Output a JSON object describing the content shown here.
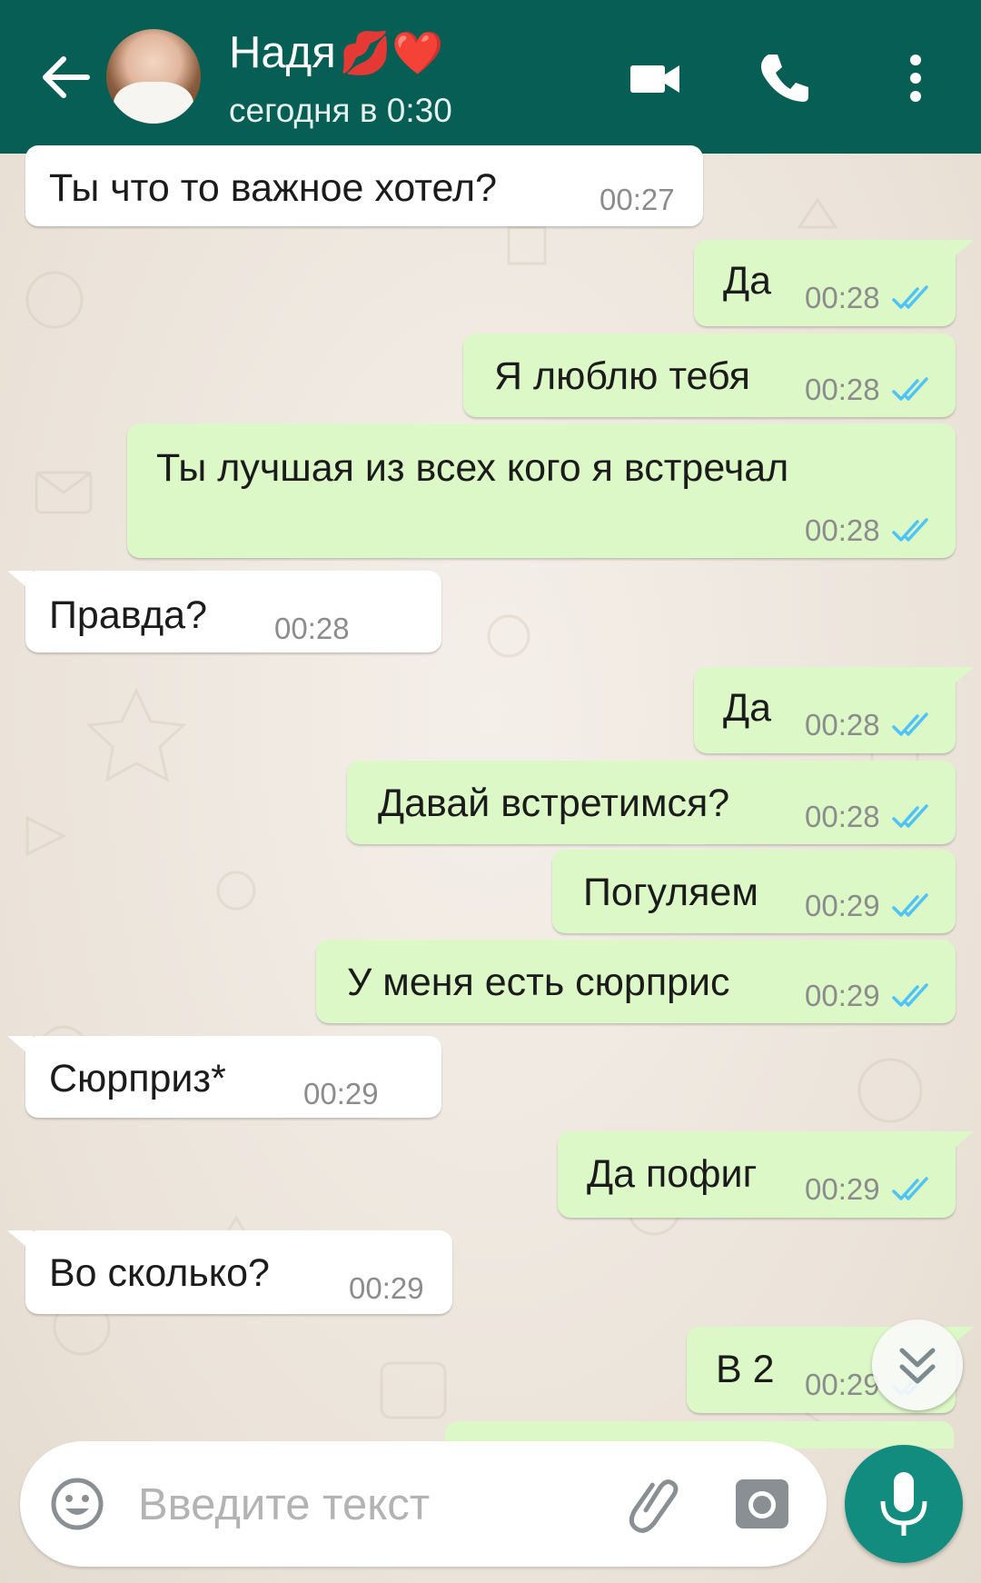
{
  "header": {
    "contact_name": "Надя",
    "name_emojis": "💋❤️",
    "status": "сегодня в 0:30",
    "icons": [
      "back-arrow-icon",
      "video-call-icon",
      "phone-icon",
      "more-vert-icon"
    ]
  },
  "messages": [
    {
      "dir": "in",
      "text": "Ты что то важное хотел?",
      "time": "00:27"
    },
    {
      "dir": "out",
      "text": "Да",
      "time": "00:28"
    },
    {
      "dir": "out",
      "text": "Я люблю тебя",
      "time": "00:28"
    },
    {
      "dir": "out",
      "text": "Ты лучшая из всех кого я встречал",
      "time": "00:28"
    },
    {
      "dir": "in",
      "text": "Правда?",
      "time": "00:28"
    },
    {
      "dir": "out",
      "text": "Да",
      "time": "00:28"
    },
    {
      "dir": "out",
      "text": "Давай встретимся?",
      "time": "00:28"
    },
    {
      "dir": "out",
      "text": "Погуляем",
      "time": "00:29"
    },
    {
      "dir": "out",
      "text": "У меня есть сюрприс",
      "time": "00:29"
    },
    {
      "dir": "in",
      "text": "Сюрприз*",
      "time": "00:29"
    },
    {
      "dir": "out",
      "text": "Да пофиг",
      "time": "00:29"
    },
    {
      "dir": "in",
      "text": "Во сколько?",
      "time": "00:29"
    },
    {
      "dir": "out",
      "text": "В 2",
      "time": "00:29"
    }
  ],
  "input": {
    "placeholder": "Введите текст",
    "icons": [
      "emoji-icon",
      "attach-icon",
      "camera-icon",
      "mic-icon"
    ]
  },
  "colors": {
    "header": "#075e54",
    "outgoing_bubble": "#dcf8c6",
    "incoming_bubble": "#ffffff",
    "read_ticks": "#4fc3f7",
    "mic_button": "#128c7e"
  }
}
